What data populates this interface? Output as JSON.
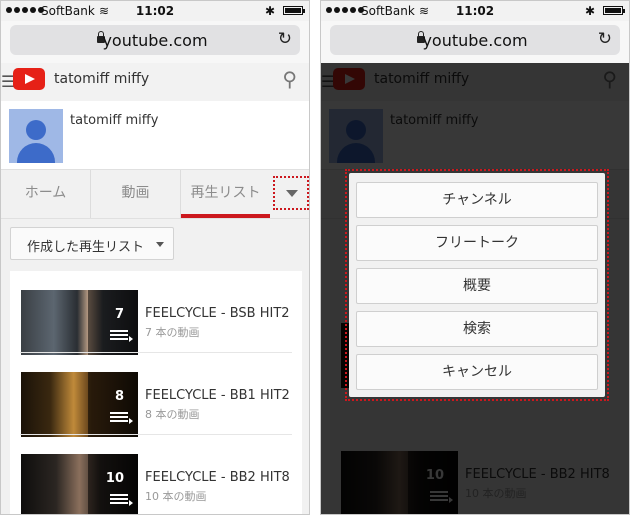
{
  "status_bar": {
    "carrier": "SoftBank",
    "time": "11:02"
  },
  "browser": {
    "url": "youtube.com"
  },
  "header": {
    "channel_name": "tatomiff miffy"
  },
  "profile": {
    "name": "tatomiff miffy"
  },
  "tabs": [
    {
      "label": "ホーム"
    },
    {
      "label": "動画"
    },
    {
      "label": "再生リスト"
    }
  ],
  "playlist_filter": {
    "selected": "作成した再生リスト"
  },
  "playlists": [
    {
      "title": "FEELCYCLE - BSB HIT2",
      "count": "7",
      "subtitle": "7 本の動画"
    },
    {
      "title": "FEELCYCLE - BB1 HIT2",
      "count": "8",
      "subtitle": "8 本の動画"
    },
    {
      "title": "FEELCYCLE - BB2 HIT8",
      "count": "10",
      "subtitle": "10 本の動画"
    }
  ],
  "dialog": {
    "options": [
      {
        "label": "チャンネル"
      },
      {
        "label": "フリートーク"
      },
      {
        "label": "概要"
      },
      {
        "label": "検索"
      },
      {
        "label": "キャンセル"
      }
    ]
  },
  "colors": {
    "accent": "#cc181e",
    "youtube_red": "#e62117",
    "overlay": "#000000"
  },
  "icons": [
    "hamburger-menu-icon",
    "youtube-logo-icon",
    "search-icon",
    "lock-icon",
    "reload-icon",
    "playlist-icon",
    "dropdown-arrow-icon"
  ]
}
